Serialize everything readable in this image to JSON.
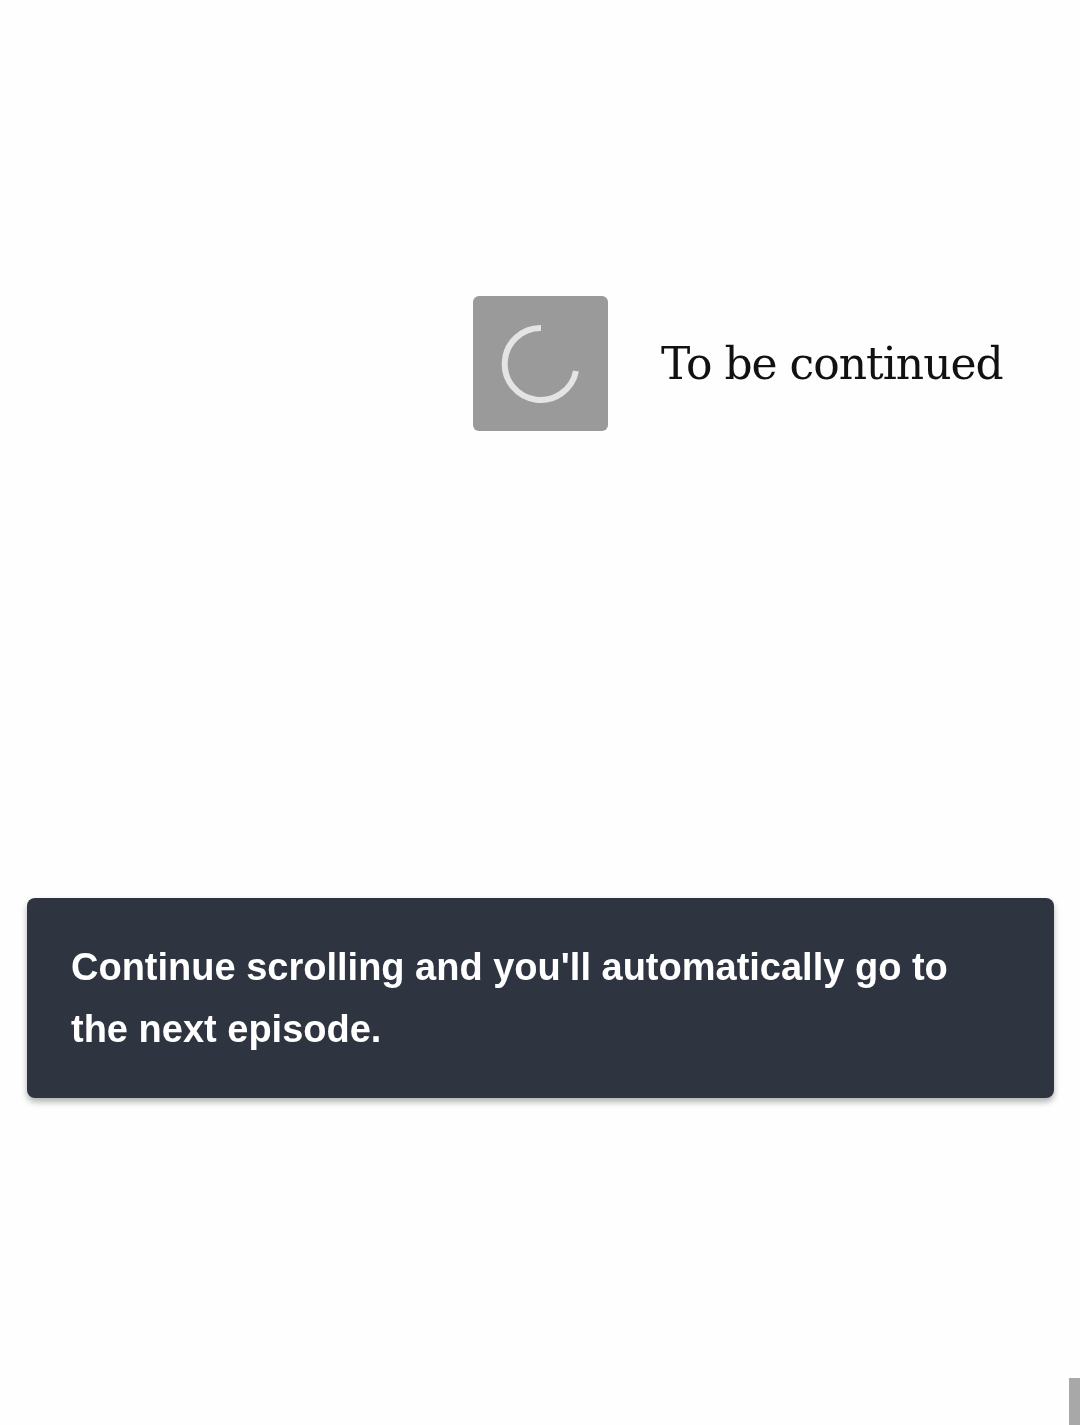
{
  "episode_end": {
    "label": "To be continued"
  },
  "toast": {
    "message": "Continue scrolling and you'll automatically go to the next episode."
  }
}
